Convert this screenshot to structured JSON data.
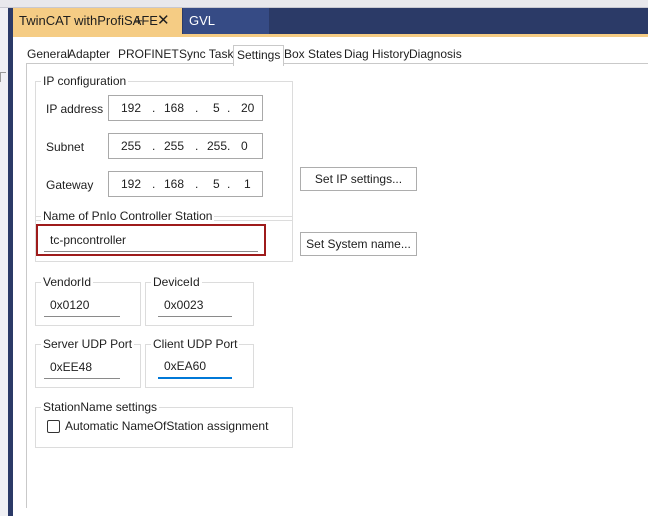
{
  "document_tabs": [
    {
      "label": "TwinCAT withProfiSAFE",
      "active": true
    },
    {
      "label": "GVL",
      "active": false
    }
  ],
  "icons": {
    "pin": "pin-icon",
    "close": "close-icon"
  },
  "sub_tabs": [
    "General",
    "Adapter",
    "PROFINET",
    "Sync Task",
    "Settings",
    "Box States",
    "Diag History",
    "Diagnosis"
  ],
  "selected_sub_tab": "Settings",
  "ip_config": {
    "title": "IP configuration",
    "ip_label": "IP address",
    "ip": [
      "192",
      "168",
      "5",
      "20"
    ],
    "subnet_label": "Subnet",
    "subnet": [
      "255",
      "255",
      "255",
      "0"
    ],
    "gateway_label": "Gateway",
    "gateway": [
      "192",
      "168",
      "5",
      "1"
    ],
    "separator": "."
  },
  "set_ip_button": "Set IP settings...",
  "station": {
    "title": "Name of PnIo Controller Station",
    "value": "tc-pncontroller"
  },
  "set_system_button": "Set System name...",
  "vendor": {
    "title": "VendorId",
    "value": "0x0120"
  },
  "device": {
    "title": "DeviceId",
    "value": "0x0023"
  },
  "server_udp": {
    "title": "Server UDP Port",
    "value": "0xEE48"
  },
  "client_udp": {
    "title": "Client UDP Port",
    "value": "0xEA60"
  },
  "station_settings": {
    "title": "StationName settings",
    "checkbox_label": "Automatic NameOfStation assignment",
    "checked": false
  },
  "colors": {
    "accent_tab": "#f5cc84",
    "tab_bar": "#2b3a67",
    "highlight": "#9e1b1b",
    "focus": "#0078d7"
  }
}
